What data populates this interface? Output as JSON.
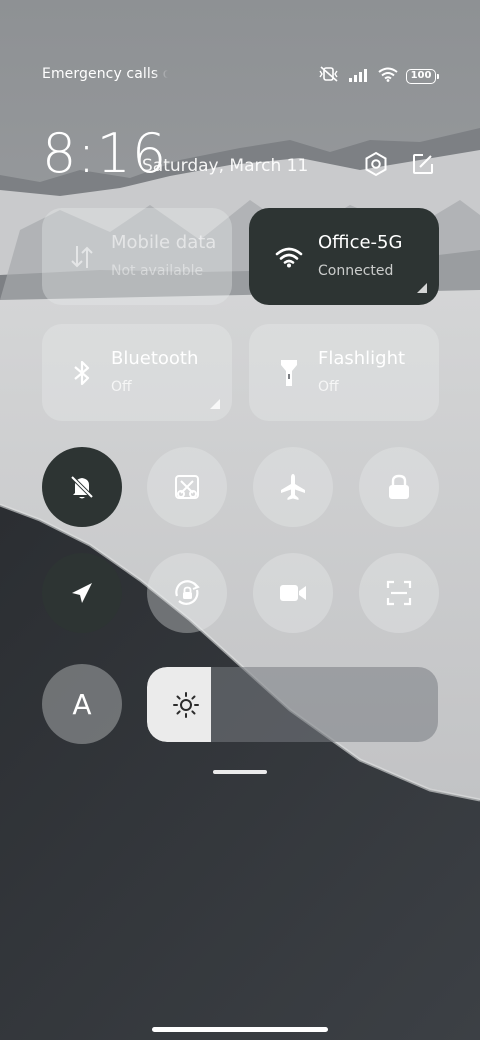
{
  "status_bar": {
    "carrier": "Emergency calls only",
    "battery": "100",
    "icons": [
      "vibrate-mute-icon",
      "signal-icon",
      "wifi-icon",
      "battery-icon"
    ]
  },
  "header": {
    "time": "8:16",
    "date": "Saturday, March 11",
    "actions": [
      "settings-icon",
      "edit-icon"
    ]
  },
  "tiles": {
    "mobile_data": {
      "title": "Mobile data",
      "subtitle": "Not available",
      "icon": "mobile-data-icon",
      "active": false
    },
    "wifi": {
      "title": "Office-5G",
      "subtitle": "Connected",
      "icon": "wifi-icon",
      "active": true
    },
    "bluetooth": {
      "title": "Bluetooth",
      "subtitle": "Off",
      "icon": "bluetooth-icon",
      "active": false
    },
    "flashlight": {
      "title": "Flashlight",
      "subtitle": "Off",
      "icon": "flashlight-icon",
      "active": false
    }
  },
  "toggles": [
    {
      "icon": "silent-bell-icon",
      "active": true
    },
    {
      "icon": "screenshot-icon",
      "active": false
    },
    {
      "icon": "airplane-icon",
      "active": false
    },
    {
      "icon": "lock-icon",
      "active": false
    },
    {
      "icon": "location-icon",
      "active": true
    },
    {
      "icon": "rotation-lock-icon",
      "active": false
    },
    {
      "icon": "screen-record-icon",
      "active": false
    },
    {
      "icon": "scan-icon",
      "active": false
    },
    {
      "icon": "font-size-icon",
      "active": false
    }
  ],
  "auto_text_label": "A",
  "brightness": {
    "level": 0.22,
    "icon": "sun-icon"
  },
  "colors": {
    "tile_active": "#2d3433",
    "tile_inactive": "rgba(235,236,238,0.34)",
    "brightness_fill": "#ebebeb"
  }
}
